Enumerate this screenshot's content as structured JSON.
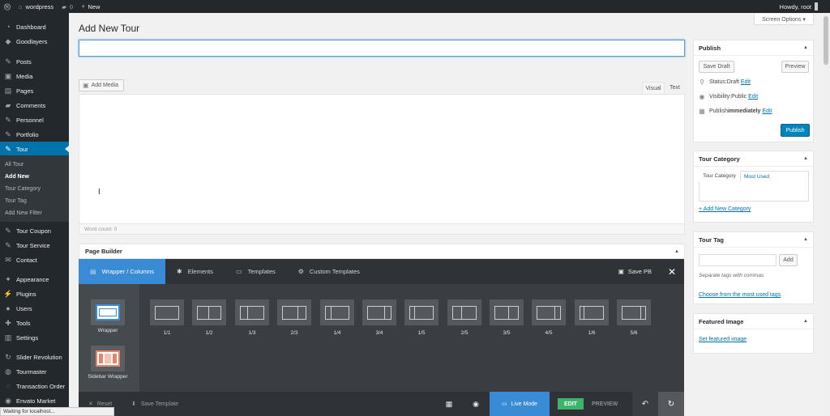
{
  "admin_bar": {
    "site_name": "wordpress",
    "comments_count": "0",
    "new_label": "New",
    "howdy": "Howdy, root"
  },
  "sidebar": {
    "items": [
      {
        "label": "Dashboard",
        "icon": "dashboard-icon"
      },
      {
        "label": "Goodlayers",
        "icon": "goodlayers-icon"
      },
      {
        "label": "Posts",
        "icon": "pin-icon"
      },
      {
        "label": "Media",
        "icon": "media-icon"
      },
      {
        "label": "Pages",
        "icon": "pages-icon"
      },
      {
        "label": "Comments",
        "icon": "comments-icon"
      },
      {
        "label": "Personnel",
        "icon": "pin-icon"
      },
      {
        "label": "Portfolio",
        "icon": "pin-icon"
      },
      {
        "label": "Tour",
        "icon": "pin-icon",
        "current": true
      },
      {
        "label": "Tour Coupon",
        "icon": "pin-icon"
      },
      {
        "label": "Tour Service",
        "icon": "pin-icon"
      },
      {
        "label": "Contact",
        "icon": "mail-icon"
      },
      {
        "label": "Appearance",
        "icon": "appearance-icon"
      },
      {
        "label": "Plugins",
        "icon": "plugins-icon"
      },
      {
        "label": "Users",
        "icon": "users-icon"
      },
      {
        "label": "Tools",
        "icon": "tools-icon"
      },
      {
        "label": "Settings",
        "icon": "settings-icon"
      },
      {
        "label": "Slider Revolution",
        "icon": "slider-icon"
      },
      {
        "label": "Tourmaster",
        "icon": "tourmaster-icon"
      },
      {
        "label": "Transaction Order",
        "icon": "transaction-icon"
      },
      {
        "label": "Envato Market",
        "icon": "envato-icon"
      }
    ],
    "submenu": [
      "All Tour",
      "Add New",
      "Tour Category",
      "Tour Tag",
      "Add New Filter"
    ]
  },
  "screen_options": "Screen Options ▾",
  "page_title": "Add New Tour",
  "title_input": {
    "value": "",
    "placeholder": ""
  },
  "editor": {
    "add_media": "Add Media",
    "tab_visual": "Visual",
    "tab_text": "Text",
    "word_count": "Word count: 0"
  },
  "page_builder": {
    "title": "Page Builder",
    "tabs": [
      "Wrapper / Columns",
      "Elements",
      "Templates",
      "Custom Templates"
    ],
    "save_label": "Save PB",
    "wrappers": [
      "Wrapper",
      "Sidebar Wrapper"
    ],
    "columns": [
      "1/1",
      "1/2",
      "1/3",
      "2/3",
      "1/4",
      "3/4",
      "1/5",
      "2/5",
      "3/5",
      "4/5",
      "1/6",
      "5/6"
    ],
    "bottom": {
      "reset": "Reset",
      "save_template": "Save Template",
      "live_mode": "Live Mode",
      "edit": "EDIT",
      "preview": "PREVIEW"
    }
  },
  "publish": {
    "title": "Publish",
    "save_draft": "Save Draft",
    "preview": "Preview",
    "status_label": "Status: ",
    "status_value": "Draft",
    "visibility_label": "Visibility: ",
    "visibility_value": "Public",
    "publish_label": "Publish ",
    "publish_value": "immediately",
    "edit_link": "Edit",
    "publish_button": "Publish"
  },
  "tour_category": {
    "title": "Tour Category",
    "tab_all": "Tour Category",
    "tab_most_used": "Most Used",
    "add_new": "+ Add New Category"
  },
  "tour_tag": {
    "title": "Tour Tag",
    "add_button": "Add",
    "hint": "Separate tags with commas",
    "choose_link": "Choose from the most used tags"
  },
  "featured_image": {
    "title": "Featured Image",
    "set_link": "Set featured image"
  },
  "status_bar": "Waiting for localhost...",
  "colors": {
    "accent": "#0073aa",
    "pb_blue": "#3a8bd6",
    "edit_green": "#3fb36b",
    "admin_dark": "#23282d"
  }
}
